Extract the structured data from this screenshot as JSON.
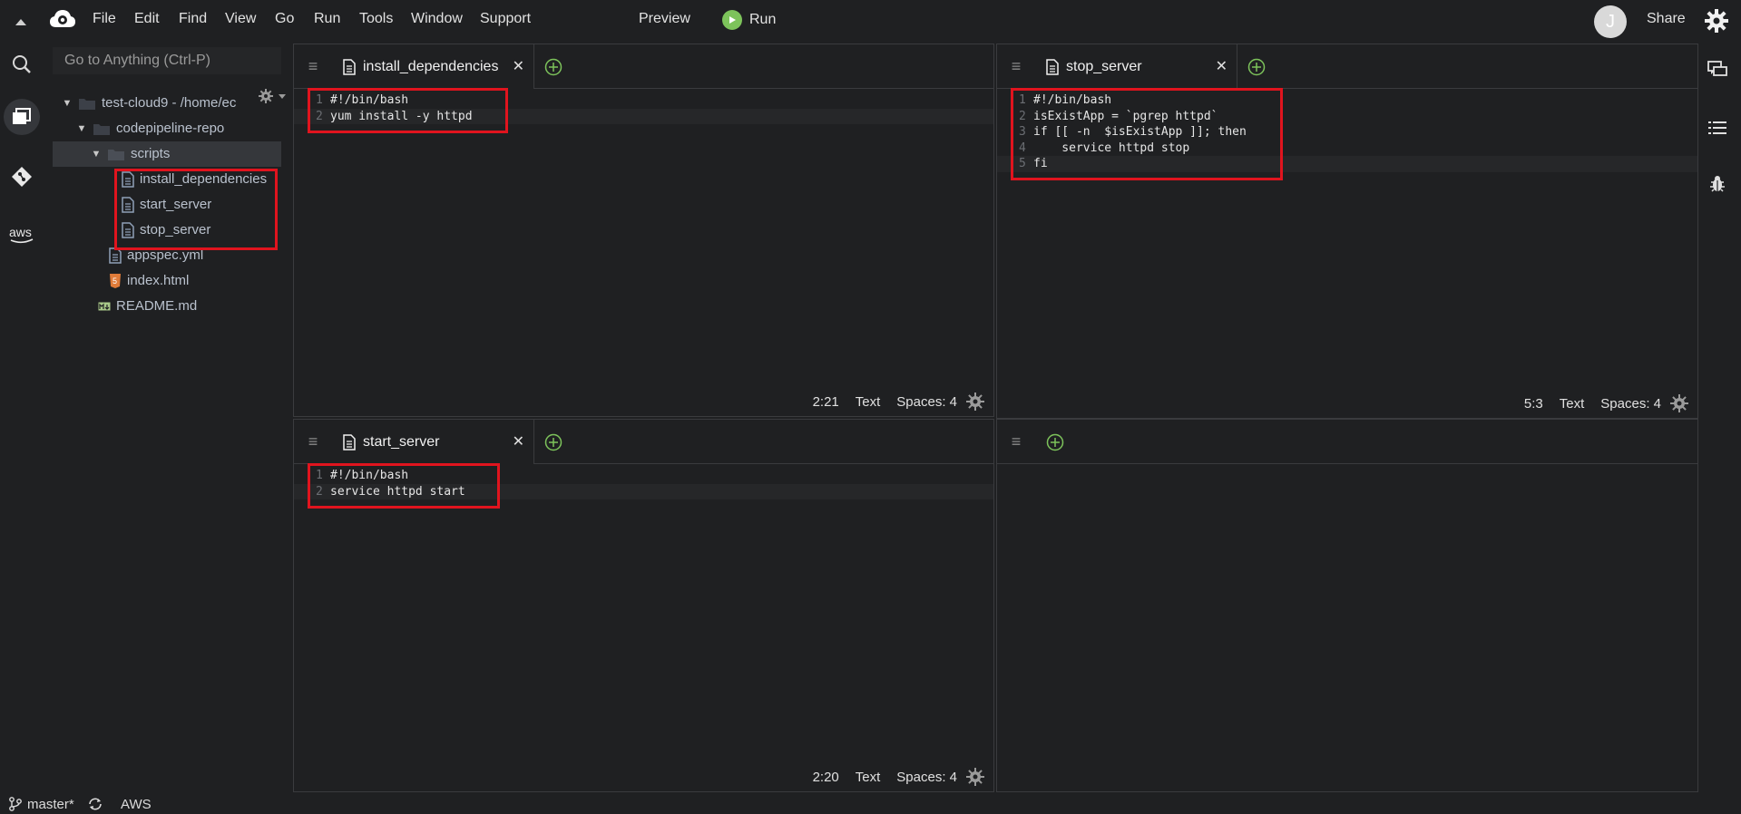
{
  "menubar": {
    "items": [
      "File",
      "Edit",
      "Find",
      "View",
      "Go",
      "Run",
      "Tools",
      "Window",
      "Support"
    ],
    "preview": "Preview",
    "run": "Run",
    "avatar_initial": "J",
    "share": "Share"
  },
  "sidebar": {
    "goto_placeholder": "Go to Anything (Ctrl-P)",
    "tree": [
      {
        "label": "test-cloud9 - /home/ec",
        "type": "folder-open",
        "depth": 0
      },
      {
        "label": "codepipeline-repo",
        "type": "folder-open",
        "depth": 1
      },
      {
        "label": "scripts",
        "type": "folder-open",
        "depth": 2,
        "selected": true
      },
      {
        "label": "install_dependencies",
        "type": "file",
        "depth": 3
      },
      {
        "label": "start_server",
        "type": "file",
        "depth": 3
      },
      {
        "label": "stop_server",
        "type": "file",
        "depth": 3
      },
      {
        "label": "appspec.yml",
        "type": "file",
        "depth": 2
      },
      {
        "label": "index.html",
        "type": "html",
        "depth": 2
      },
      {
        "label": "README.md",
        "type": "markdown",
        "depth": 1
      }
    ]
  },
  "panes": {
    "top_left": {
      "tab": "install_dependencies",
      "lines": [
        "#!/bin/bash",
        "yum install -y httpd"
      ],
      "active_line": 2,
      "cursor": "2:21",
      "mode": "Text",
      "spaces": "Spaces: 4"
    },
    "top_right": {
      "tab": "stop_server",
      "lines": [
        "#!/bin/bash",
        "isExistApp = `pgrep httpd`",
        "if [[ -n  $isExistApp ]]; then",
        "    service httpd stop",
        "fi"
      ],
      "active_line": 5,
      "cursor": "5:3",
      "mode": "Text",
      "spaces": "Spaces: 4"
    },
    "bottom_left": {
      "tab": "start_server",
      "lines": [
        "#!/bin/bash",
        "service httpd start"
      ],
      "active_line": 2,
      "cursor": "2:20",
      "mode": "Text",
      "spaces": "Spaces: 4"
    },
    "bottom_right": {}
  },
  "bottom": {
    "branch": "master*",
    "aws": "AWS"
  },
  "colors": {
    "background": "#1f2022",
    "highlight_box": "#e0141e",
    "run_green": "#7dc35b",
    "add_tab_green": "#7dc35b"
  }
}
